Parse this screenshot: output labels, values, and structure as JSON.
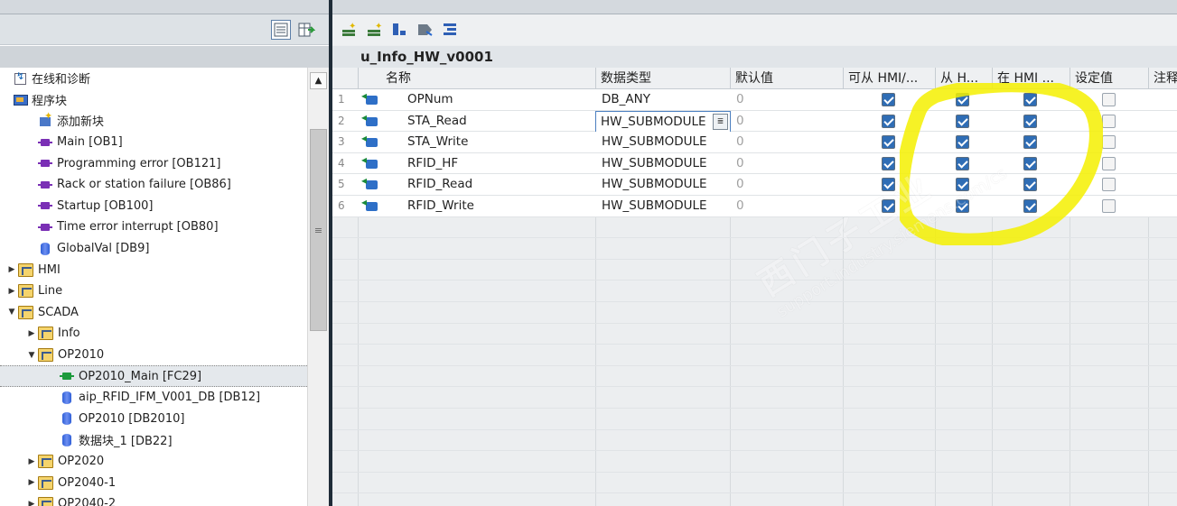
{
  "tree": {
    "items": [
      {
        "label": "在线和诊断",
        "icon": "online-diagnostics-icon",
        "indent": 0,
        "expander": ""
      },
      {
        "label": "程序块",
        "icon": "program-blocks-icon",
        "indent": 0,
        "expander": ""
      },
      {
        "label": "添加新块",
        "icon": "add-block-icon",
        "indent": 1,
        "expander": ""
      },
      {
        "label": "Main [OB1]",
        "icon": "ob-block-icon",
        "indent": 1,
        "expander": ""
      },
      {
        "label": "Programming error [OB121]",
        "icon": "ob-block-icon",
        "indent": 1,
        "expander": ""
      },
      {
        "label": "Rack or station failure [OB86]",
        "icon": "ob-block-icon",
        "indent": 1,
        "expander": ""
      },
      {
        "label": "Startup [OB100]",
        "icon": "ob-block-icon",
        "indent": 1,
        "expander": ""
      },
      {
        "label": "Time error interrupt [OB80]",
        "icon": "ob-block-icon",
        "indent": 1,
        "expander": ""
      },
      {
        "label": "GlobalVal [DB9]",
        "icon": "db-icon",
        "indent": 1,
        "expander": ""
      },
      {
        "label": "HMI",
        "icon": "folder-icon",
        "indent": 0,
        "expander": "▶"
      },
      {
        "label": "Line",
        "icon": "folder-icon",
        "indent": 0,
        "expander": "▶"
      },
      {
        "label": "SCADA",
        "icon": "folder-icon",
        "indent": 0,
        "expander": "▼"
      },
      {
        "label": "Info",
        "icon": "folder-icon",
        "indent": 1,
        "expander": "▶"
      },
      {
        "label": "OP2010",
        "icon": "folder-icon",
        "indent": 1,
        "expander": "▼"
      },
      {
        "label": "OP2010_Main [FC29]",
        "icon": "fc-block-icon",
        "indent": 2,
        "expander": "",
        "selected": true
      },
      {
        "label": "aip_RFID_IFM_V001_DB [DB12]",
        "icon": "db-icon",
        "indent": 2,
        "expander": ""
      },
      {
        "label": "OP2010 [DB2010]",
        "icon": "db-icon",
        "indent": 2,
        "expander": ""
      },
      {
        "label": "数据块_1 [DB22]",
        "icon": "db-icon",
        "indent": 2,
        "expander": ""
      },
      {
        "label": "OP2020",
        "icon": "folder-icon",
        "indent": 1,
        "expander": "▶"
      },
      {
        "label": "OP2040-1",
        "icon": "folder-icon",
        "indent": 1,
        "expander": "▶"
      },
      {
        "label": "OP2040-2",
        "icon": "folder-icon",
        "indent": 1,
        "expander": "▶"
      }
    ]
  },
  "editor": {
    "block_title": "u_Info_HW_v0001",
    "columns": [
      "",
      "名称",
      "数据类型",
      "默认值",
      "可从 HMI/...",
      "从 H...",
      "在 HMI ...",
      "设定值",
      "注释"
    ],
    "rows": [
      {
        "num": "1",
        "name": "OPNum",
        "type": "DB_ANY",
        "default": "0",
        "hmi_access": true,
        "from_hmi": true,
        "in_hmi": true,
        "setpoint": false
      },
      {
        "num": "2",
        "name": "STA_Read",
        "type": "HW_SUBMODULE",
        "default": "0",
        "hmi_access": true,
        "from_hmi": true,
        "in_hmi": true,
        "setpoint": false,
        "editing": true
      },
      {
        "num": "3",
        "name": "STA_Write",
        "type": "HW_SUBMODULE",
        "default": "0",
        "hmi_access": true,
        "from_hmi": true,
        "in_hmi": true,
        "setpoint": false
      },
      {
        "num": "4",
        "name": "RFID_HF",
        "type": "HW_SUBMODULE",
        "default": "0",
        "hmi_access": true,
        "from_hmi": true,
        "in_hmi": true,
        "setpoint": false
      },
      {
        "num": "5",
        "name": "RFID_Read",
        "type": "HW_SUBMODULE",
        "default": "0",
        "hmi_access": true,
        "from_hmi": true,
        "in_hmi": true,
        "setpoint": false
      },
      {
        "num": "6",
        "name": "RFID_Write",
        "type": "HW_SUBMODULE",
        "default": "0",
        "hmi_access": true,
        "from_hmi": true,
        "in_hmi": true,
        "setpoint": false
      }
    ]
  },
  "watermark": {
    "line1": "西门子工业",
    "line2": "support.industry.siemens.com/cs"
  },
  "colors": {
    "highlight": "#f4f000",
    "checkbox": "#2f6db5",
    "divider": "#1f2c38"
  }
}
